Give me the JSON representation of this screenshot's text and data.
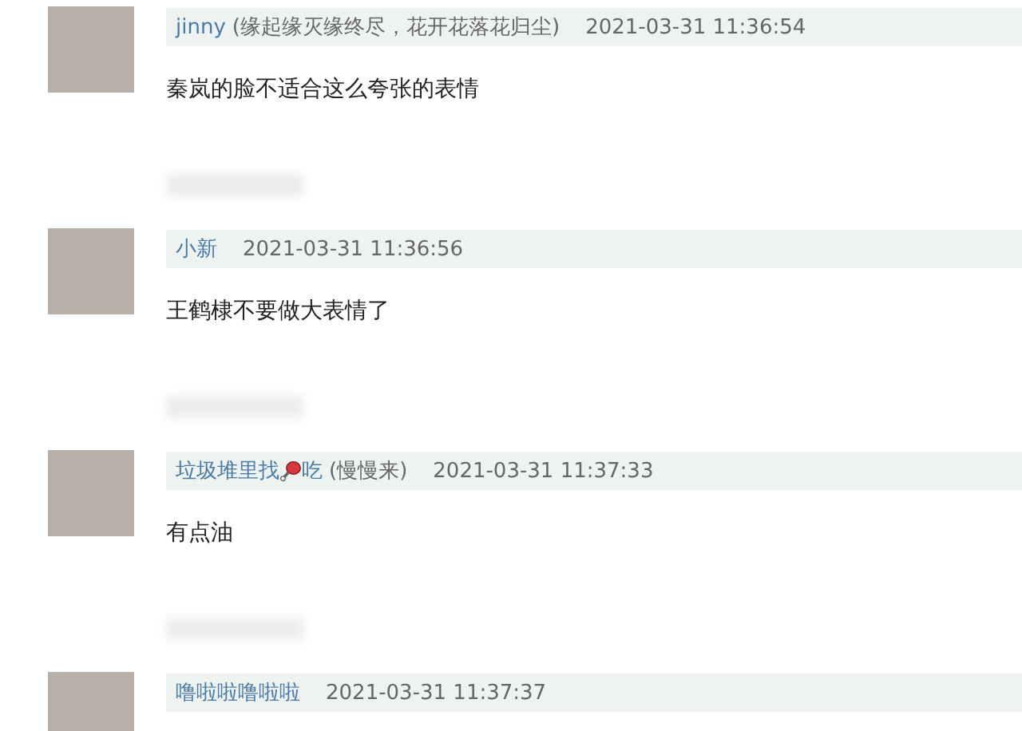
{
  "comments": [
    {
      "name": "jinny",
      "note": "(缘起缘灭缘终尽，花开花落花归尘)",
      "time": "2021-03-31 11:36:54",
      "text": "秦岚的脸不适合这么夸张的表情"
    },
    {
      "name": "小新",
      "time": "2021-03-31 11:36:56",
      "text": "王鹤棣不要做大表情了"
    },
    {
      "name": "垃圾堆里找",
      "name_icon": true,
      "name_tail": "吃",
      "note": "(慢慢来)",
      "time": "2021-03-31 11:37:33",
      "text": "有点油"
    },
    {
      "name": "噜啦啦噜啦啦",
      "time": "2021-03-31 11:37:37"
    }
  ]
}
